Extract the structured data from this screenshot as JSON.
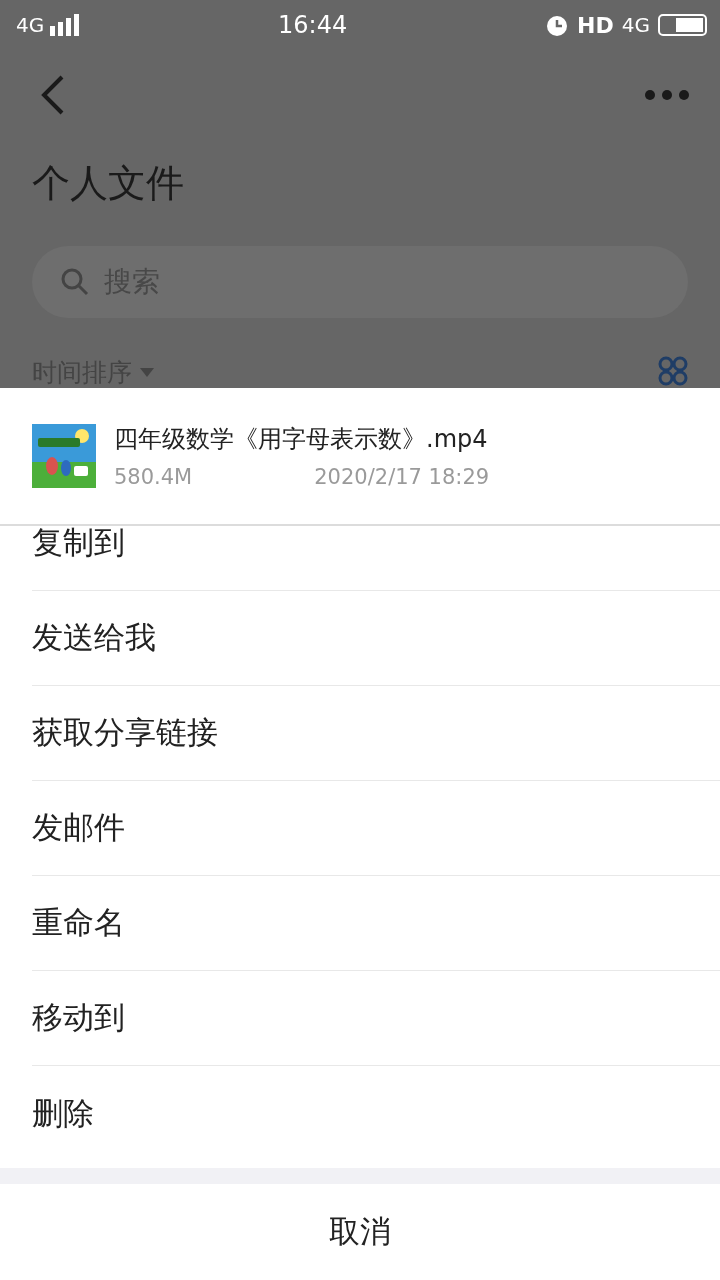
{
  "status_bar": {
    "network_left": "4G",
    "time": "16:44",
    "hd": "HD",
    "network_right": "4G"
  },
  "page": {
    "title": "个人文件",
    "search": {
      "placeholder": "搜索"
    },
    "sort": "时间排序"
  },
  "sheet": {
    "file": {
      "name": "四年级数学《用字母表示数》.mp4",
      "size": "580.4M",
      "date": "2020/2/17 18:29"
    },
    "actions": [
      {
        "label": "复制到"
      },
      {
        "label": "发送给我"
      },
      {
        "label": "获取分享链接"
      },
      {
        "label": "发邮件"
      },
      {
        "label": "重命名"
      },
      {
        "label": "移动到"
      },
      {
        "label": "删除"
      }
    ],
    "cancel": "取消"
  }
}
